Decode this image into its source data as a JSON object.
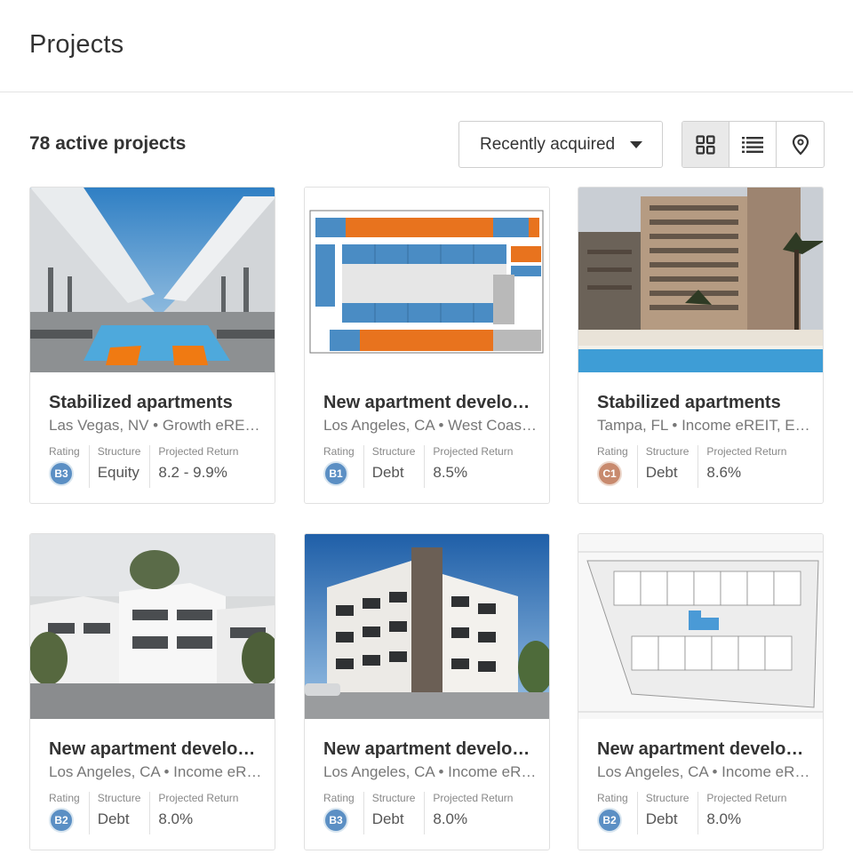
{
  "header": {
    "title": "Projects"
  },
  "toolbar": {
    "count_label": "78 active projects",
    "sort": {
      "selected": "Recently acquired"
    },
    "view_modes": [
      {
        "icon": "grid-icon",
        "active": true
      },
      {
        "icon": "list-icon",
        "active": false
      },
      {
        "icon": "map-pin-icon",
        "active": false
      }
    ]
  },
  "labels": {
    "rating": "Rating",
    "structure": "Structure",
    "projected_return": "Projected Return"
  },
  "colors": {
    "rating_blue": "#5b8fc4",
    "rating_orange": "#c88a6e",
    "floor_orange": "#e8731e",
    "floor_blue": "#4a8cc4"
  },
  "cards": [
    {
      "title": "Stabilized apartments",
      "subtitle": "Las Vegas, NV • Growth eREIT, West Coast eREIT",
      "rating": "B3",
      "structure": "Equity",
      "projected_return": "8.2 - 9.9%",
      "image": "rooftop-pool-photo"
    },
    {
      "title": "New apartment development",
      "subtitle": "Los Angeles, CA • West Coast eREIT",
      "rating": "B1",
      "structure": "Debt",
      "projected_return": "8.5%",
      "image": "floor-plan-drawing"
    },
    {
      "title": "Stabilized apartments",
      "subtitle": "Tampa, FL • Income eREIT, East Coast eREIT",
      "rating": "C1",
      "structure": "Debt",
      "projected_return": "8.6%",
      "image": "high-rise-pool-photo"
    },
    {
      "title": "New apartment development",
      "subtitle": "Los Angeles, CA • Income eREIT",
      "rating": "B2",
      "structure": "Debt",
      "projected_return": "8.0%",
      "image": "white-apartments-rendering"
    },
    {
      "title": "New apartment development",
      "subtitle": "Los Angeles, CA • Income eREIT",
      "rating": "B3",
      "structure": "Debt",
      "projected_return": "8.0%",
      "image": "modern-building-rendering"
    },
    {
      "title": "New apartment development",
      "subtitle": "Los Angeles, CA • Income eREIT",
      "rating": "B2",
      "structure": "Debt",
      "projected_return": "8.0%",
      "image": "site-plan-drawing"
    }
  ]
}
